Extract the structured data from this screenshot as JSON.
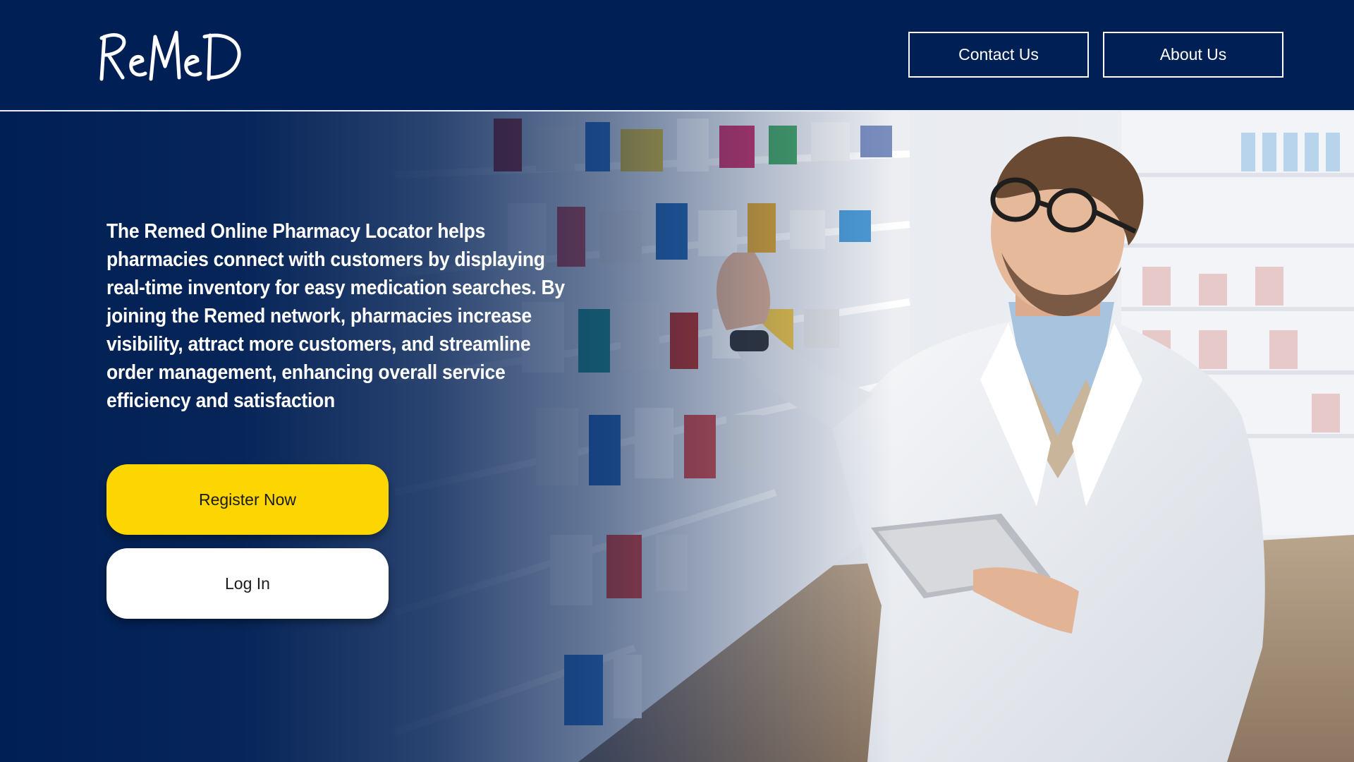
{
  "header": {
    "logo_text": "ReMeD",
    "nav": {
      "contact_label": "Contact Us",
      "about_label": "About Us"
    }
  },
  "hero": {
    "description": "The Remed Online Pharmacy Locator helps pharmacies connect with customers by displaying real-time inventory for easy medication searches. By joining the Remed network, pharmacies increase visibility, attract more customers, and streamline order management, enhancing overall service efficiency and satisfaction",
    "register_label": "Register Now",
    "login_label": "Log In",
    "background_image": "pharmacist-with-tablet-photo"
  },
  "colors": {
    "brand_navy": "#001f54",
    "accent_yellow": "#fdd500",
    "white": "#ffffff"
  }
}
